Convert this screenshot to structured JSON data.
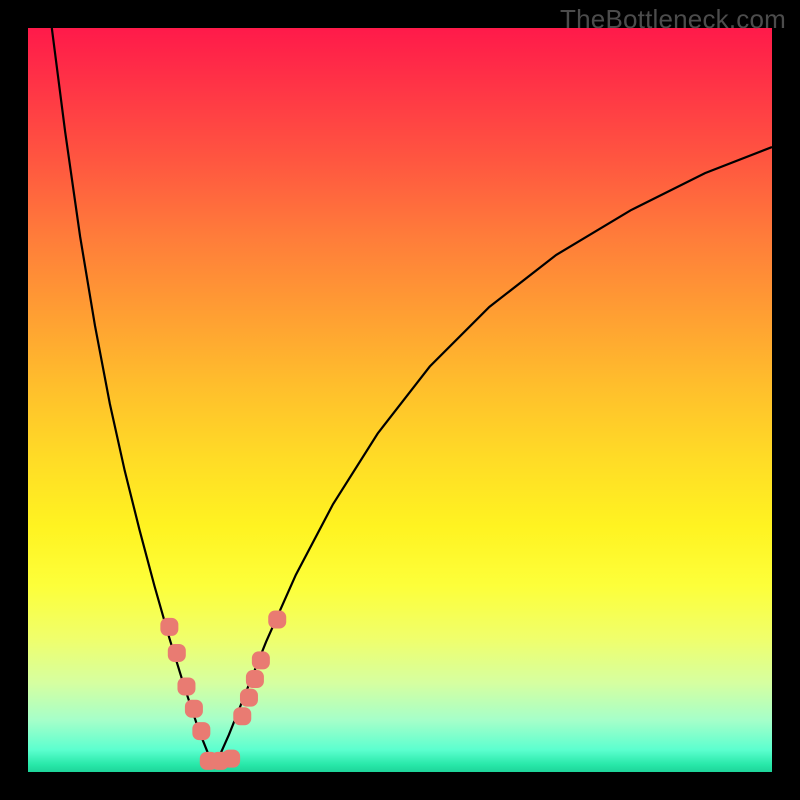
{
  "watermark": "TheBottleneck.com",
  "colors": {
    "frame": "#000000",
    "curve_stroke": "#000000",
    "marker_fill": "#e97b72",
    "gradient_top": "#ff1a4a",
    "gradient_bottom": "#1ed49a"
  },
  "chart_data": {
    "type": "line",
    "title": "",
    "xlabel": "",
    "ylabel": "",
    "xlim": [
      0,
      100
    ],
    "ylim": [
      0,
      100
    ],
    "note": "No axis tick numbers are visible; x and y are normalized 0–100 left→right and bottom→top, read off the plot area.",
    "series": [
      {
        "name": "left_curve",
        "x": [
          3.2,
          5.0,
          7.0,
          9.0,
          11.0,
          13.0,
          15.0,
          17.0,
          19.0,
          21.0,
          23.0,
          25.0
        ],
        "y": [
          100.0,
          86.0,
          72.0,
          60.0,
          49.5,
          40.5,
          32.5,
          25.0,
          18.0,
          11.5,
          5.5,
          0.5
        ]
      },
      {
        "name": "right_curve",
        "x": [
          25.0,
          27.0,
          29.0,
          32.0,
          36.0,
          41.0,
          47.0,
          54.0,
          62.0,
          71.0,
          81.0,
          91.0,
          100.0
        ],
        "y": [
          0.5,
          5.0,
          10.0,
          17.5,
          26.5,
          36.0,
          45.5,
          54.5,
          62.5,
          69.5,
          75.5,
          80.5,
          84.0
        ]
      }
    ],
    "markers": [
      {
        "name": "left-marker-1",
        "series": "left_curve",
        "x": 19.0,
        "y": 19.5
      },
      {
        "name": "left-marker-2",
        "series": "left_curve",
        "x": 20.0,
        "y": 16.0
      },
      {
        "name": "left-marker-3",
        "series": "left_curve",
        "x": 21.3,
        "y": 11.5
      },
      {
        "name": "left-marker-4",
        "series": "left_curve",
        "x": 22.3,
        "y": 8.5
      },
      {
        "name": "left-marker-5",
        "series": "left_curve",
        "x": 23.3,
        "y": 5.5
      },
      {
        "name": "bottom-marker-1",
        "series": "left_curve",
        "x": 24.3,
        "y": 1.5
      },
      {
        "name": "bottom-marker-2",
        "series": "right_curve",
        "x": 25.8,
        "y": 1.5
      },
      {
        "name": "bottom-marker-3",
        "series": "right_curve",
        "x": 27.3,
        "y": 1.8
      },
      {
        "name": "right-marker-1",
        "series": "right_curve",
        "x": 28.8,
        "y": 7.5
      },
      {
        "name": "right-marker-2",
        "series": "right_curve",
        "x": 29.7,
        "y": 10.0
      },
      {
        "name": "right-marker-3",
        "series": "right_curve",
        "x": 30.5,
        "y": 12.5
      },
      {
        "name": "right-marker-4",
        "series": "right_curve",
        "x": 31.3,
        "y": 15.0
      },
      {
        "name": "right-marker-5",
        "series": "right_curve",
        "x": 33.5,
        "y": 20.5
      }
    ],
    "marker_radius_px": 9,
    "marker_shape": "rounded-rect"
  }
}
